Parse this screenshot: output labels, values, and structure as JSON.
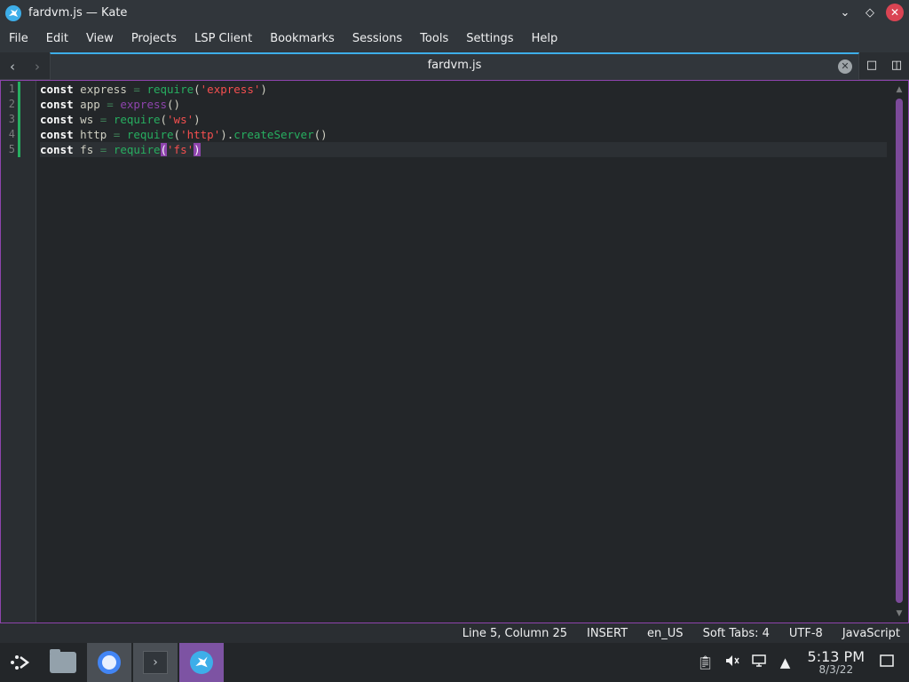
{
  "window": {
    "title": "fardvm.js — Kate",
    "app_icon": "kate-icon",
    "controls": [
      "minimize-icon",
      "maximize-icon",
      "close-icon"
    ]
  },
  "menu": {
    "items": [
      "File",
      "Edit",
      "View",
      "Projects",
      "LSP Client",
      "Bookmarks",
      "Sessions",
      "Tools",
      "Settings",
      "Help"
    ]
  },
  "tabs": {
    "active": "fardvm.js"
  },
  "editor": {
    "line_numbers": [
      "1",
      "2",
      "3",
      "4",
      "5"
    ],
    "accent": "#8e44ad",
    "modified_marker_color": "#27ae60"
  },
  "status": {
    "position": "Line 5, Column 25",
    "mode": "INSERT",
    "dictionary": "en_US",
    "indent": "Soft Tabs: 4",
    "encoding": "UTF-8",
    "language": "JavaScript"
  },
  "taskbar": {
    "apps": [
      "file-manager",
      "chromium",
      "terminal",
      "kate"
    ],
    "tray": [
      "clipboard-icon",
      "volume-muted-icon",
      "network-icon",
      "expand-tray-icon",
      "show-desktop-icon"
    ],
    "time": "5:13 PM",
    "date": "8/3/22"
  }
}
